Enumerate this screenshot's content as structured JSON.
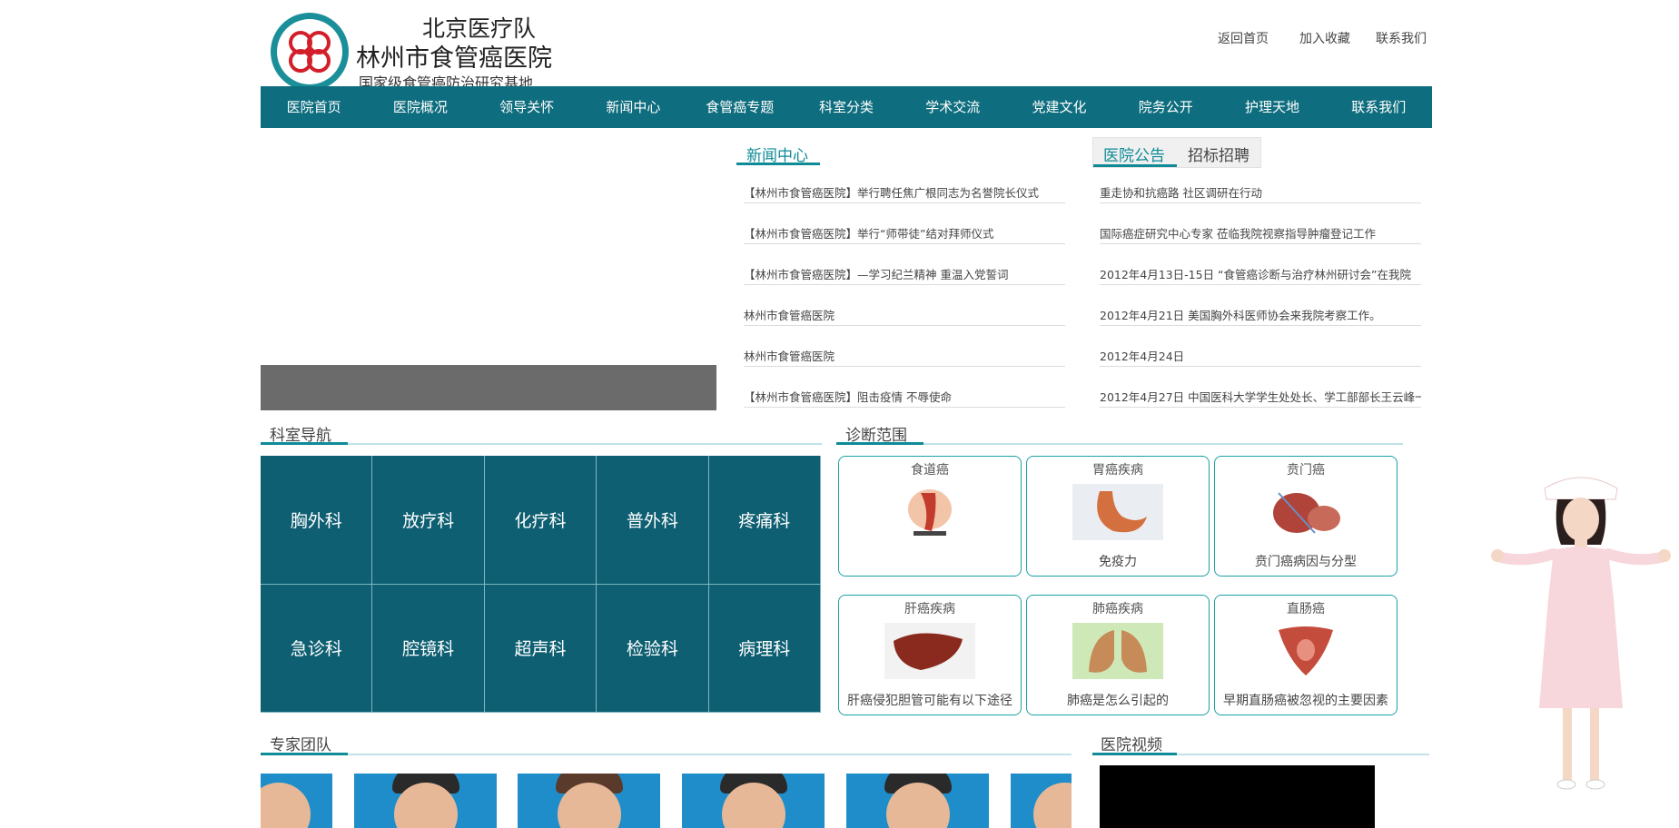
{
  "header": {
    "brand_line1": "北京医疗队",
    "brand_line2": "林州市食管癌医院",
    "brand_line3": "国家级食管癌防治研究基地",
    "top_links": [
      "返回首页",
      "加入收藏",
      "联系我们"
    ]
  },
  "nav": {
    "items": [
      "医院首页",
      "医院概况",
      "领导关怀",
      "新闻中心",
      "食管癌专题",
      "科室分类",
      "学术交流",
      "党建文化",
      "院务公开",
      "护理天地",
      "联系我们"
    ]
  },
  "news": {
    "title": "新闻中心",
    "items": [
      "【林州市食管癌医院】举行聘任焦广根同志为名誉院长仪式",
      "【林州市食管癌医院】举行“师带徒”结对拜师仪式",
      "【林州市食管癌医院】—学习纪兰精神 重温入党誓词",
      "林州市食管癌医院",
      "林州市食管癌医院",
      "【林州市食管癌医院】阻击疫情 不辱使命"
    ]
  },
  "notice": {
    "tabs": [
      "医院公告",
      "招标招聘"
    ],
    "items": [
      "重走协和抗癌路 社区调研在行动",
      "国际癌症研究中心专家 莅临我院视察指导肿瘤登记工作",
      "2012年4月13日-15日 “食管癌诊断与治疗林州研讨会”在我院",
      "2012年4月21日 美国胸外科医师协会来我院考察工作。",
      "2012年4月24日",
      "2012年4月27日 中国医科大学学生处处长、学工部部长王云峰一"
    ]
  },
  "departments": {
    "title": "科室导航",
    "items": [
      "胸外科",
      "放疗科",
      "化疗科",
      "普外科",
      "疼痛科",
      "急诊科",
      "腔镜科",
      "超声科",
      "检验科",
      "病理科"
    ]
  },
  "diagnosis": {
    "title": "诊断范围",
    "cards": [
      {
        "title": "食道癌",
        "caption": ""
      },
      {
        "title": "胃癌疾病",
        "caption": "免疫力"
      },
      {
        "title": "贲门癌",
        "caption": "贲门癌病因与分型"
      },
      {
        "title": "肝癌疾病",
        "caption": "肝癌侵犯胆管可能有以下途径"
      },
      {
        "title": "肺癌疾病",
        "caption": "肺癌是怎么引起的"
      },
      {
        "title": "直肠癌",
        "caption": "早期直肠癌被忽视的主要因素"
      }
    ]
  },
  "experts": {
    "title": "专家团队"
  },
  "video": {
    "title": "医院视频"
  },
  "colors": {
    "nav_bg": "#0e6d7e",
    "dept_bg": "#0e5f72",
    "accent": "#0e8b97",
    "card_border": "#1aa0a5"
  }
}
